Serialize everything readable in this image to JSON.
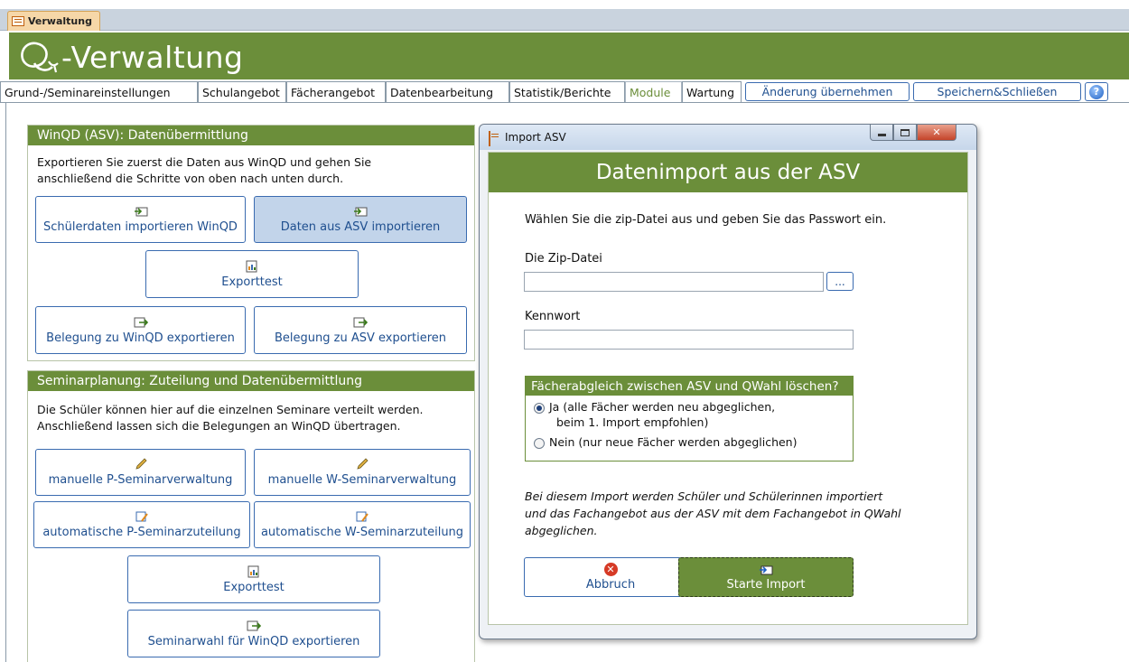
{
  "document_tab": {
    "label": "Verwaltung",
    "icon": "form-icon"
  },
  "app": {
    "title": "-Verwaltung",
    "logo": "qwahl-logo-icon"
  },
  "menu": {
    "tabs": [
      "Grund-/Seminareinstellungen",
      "Schulangebot",
      "Fächerangebot",
      "Datenbearbeitung",
      "Statistik/Berichte",
      "Module",
      "Wartung"
    ],
    "active_tab": "Module",
    "apply_button": "Änderung übernehmen",
    "save_close_button": "Speichern&Schließen",
    "help_icon": "help-icon"
  },
  "winqd_panel": {
    "title": "WinQD (ASV): Datenübermittlung",
    "text_line1": "Exportieren Sie zuerst die Daten aus WinQD und gehen Sie",
    "text_line2": "anschließend die Schritte von oben nach unten durch.",
    "btn_import_winqd": "Schülerdaten importieren WinQD",
    "btn_import_asv": "Daten aus ASV importieren",
    "btn_exporttest": "Exporttest",
    "btn_export_winqd": "Belegung zu WinQD exportieren",
    "btn_export_asv": "Belegung zu ASV exportieren"
  },
  "seminar_panel": {
    "title": "Seminarplanung: Zuteilung und Datenübermittlung",
    "text_line1": "Die Schüler können hier auf die einzelnen Seminare verteilt werden.",
    "text_line2": "Anschließend lassen sich die Belegungen an WinQD übertragen.",
    "btn_manual_p": "manuelle P-Seminarverwaltung",
    "btn_manual_w": "manuelle W-Seminarverwaltung",
    "btn_auto_p": "automatische P-Seminarzuteilung",
    "btn_auto_w": "automatische W-Seminarzuteilung",
    "btn_exporttest": "Exporttest",
    "btn_export_seminarwahl": "Seminarwahl für WinQD exportieren"
  },
  "dialog": {
    "window_title": "Import ASV",
    "header": "Datenimport aus der ASV",
    "instruction": "Wählen Sie die zip-Datei aus und geben Sie das Passwort ein.",
    "zip_label": "Die Zip-Datei",
    "zip_value": "",
    "browse_label": "...",
    "password_label": "Kennwort",
    "password_value": "",
    "option_group_title": "Fächerabgleich zwischen ASV und QWahl löschen?",
    "option_yes_line1": "Ja (alle Fächer werden neu abgeglichen,",
    "option_yes_line2": "beim 1. Import empfohlen)",
    "option_no": "Nein (nur neue Fächer werden abgeglichen)",
    "selected_option": "yes",
    "note_line1": "Bei diesem Import werden Schüler und Schülerinnen importiert",
    "note_line2": "und das Fachangebot aus der ASV mit dem Fachangebot in QWahl",
    "note_line3": "abgeglichen.",
    "cancel_button": "Abbruch",
    "start_button": "Starte Import"
  },
  "colors": {
    "accent_green": "#6b8e3a",
    "button_blue": "#1f4f8f",
    "selected_button_bg": "#c2d4ea"
  }
}
